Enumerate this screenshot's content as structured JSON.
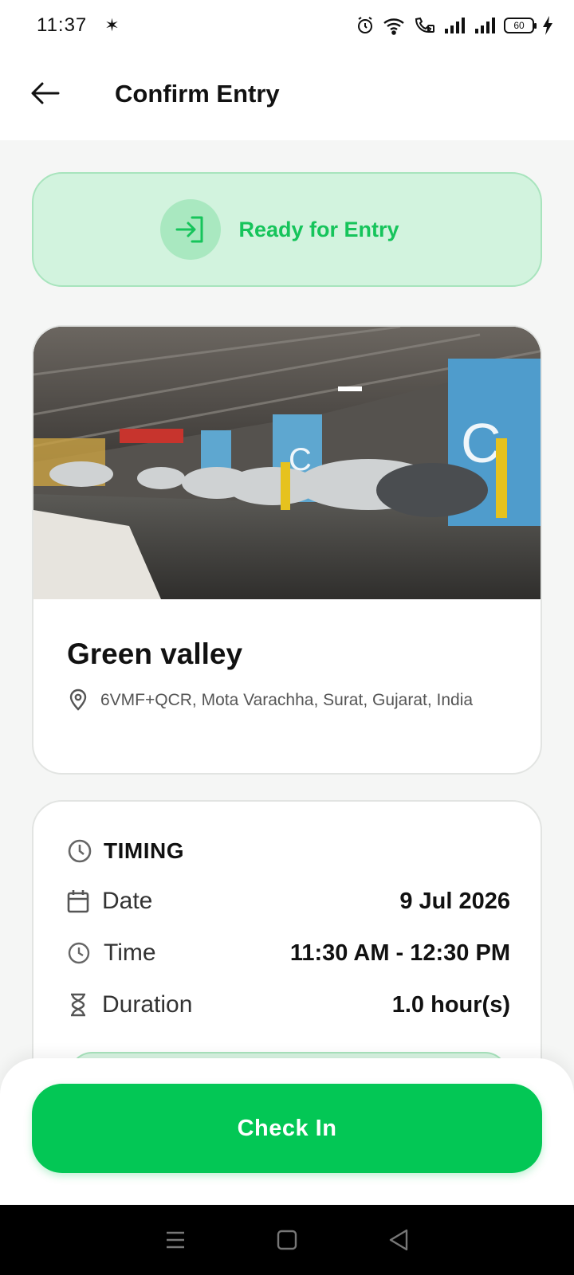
{
  "status_bar": {
    "time": "11:37",
    "battery": "60"
  },
  "header": {
    "title": "Confirm Entry"
  },
  "entry_status": {
    "label": "Ready for Entry"
  },
  "parking_lot": {
    "name": "Green valley",
    "address": "6VMF+QCR, Mota Varachha, Surat, Gujarat, India"
  },
  "timing": {
    "title": "TIMING",
    "rows": [
      {
        "label": "Date",
        "value": "9 Jul 2026"
      },
      {
        "label": "Time",
        "value": "11:30 AM - 12:30 PM"
      },
      {
        "label": "Duration",
        "value": "1.0 hour(s)"
      }
    ]
  },
  "actions": {
    "check_in": "Check In"
  },
  "colors": {
    "accent": "#03c755",
    "ready_bg": "#d2f3de"
  }
}
